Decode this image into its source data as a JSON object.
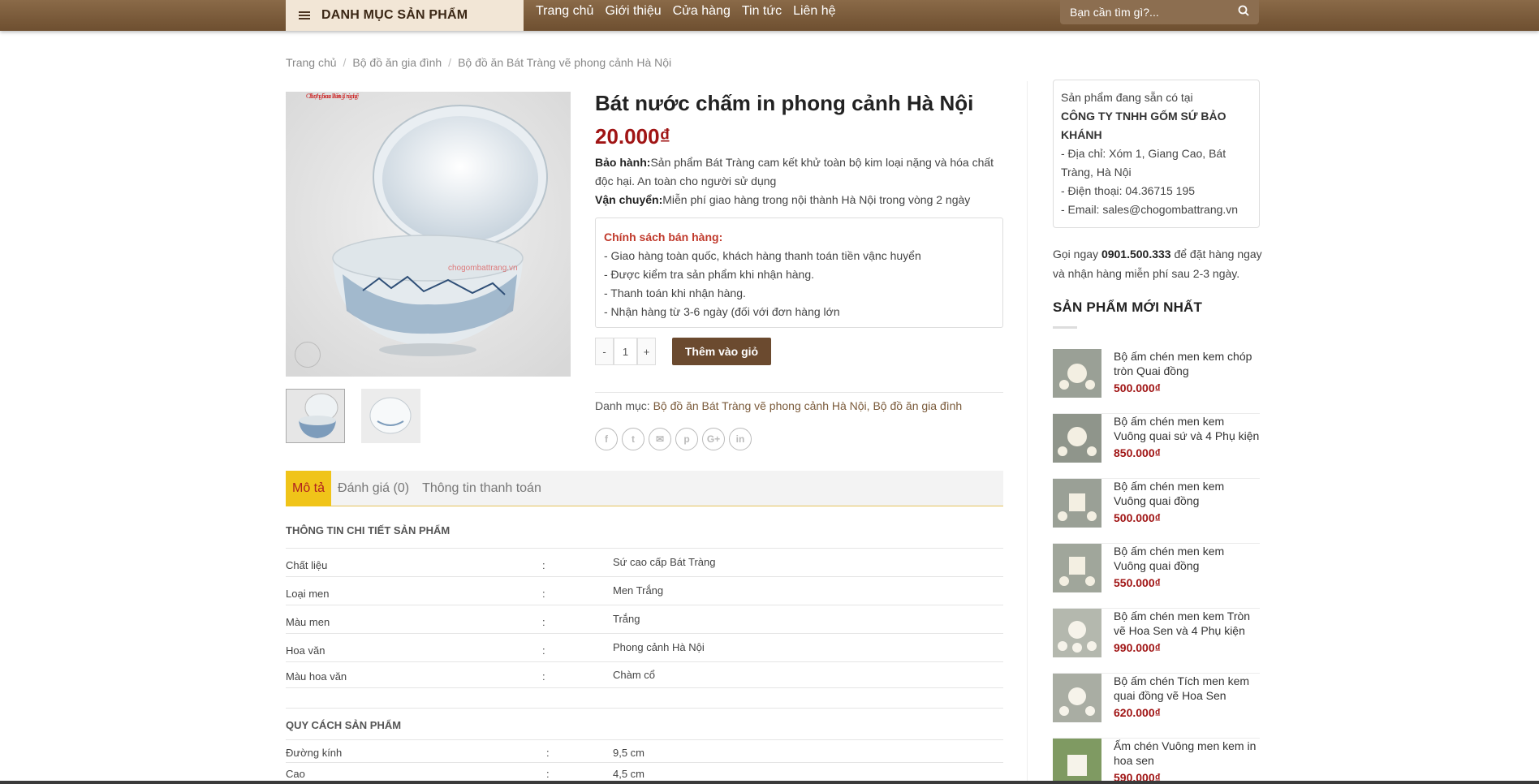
{
  "header": {
    "category_menu_label": "DANH MỤC SẢN PHẨM",
    "nav": [
      "Trang chủ",
      "Giới thiệu",
      "Cửa hàng",
      "Tin tức",
      "Liên hệ"
    ],
    "search_placeholder": "Bạn cần tìm gì?..."
  },
  "breadcrumb": [
    "Trang chủ",
    "Bộ đồ ăn gia đình",
    "Bộ đồ ăn Bát Tràng vẽ phong cảnh Hà Nội"
  ],
  "product": {
    "title": "Bát nước chấm in phong cảnh Hà Nội",
    "price": "20.000₫",
    "warranty_label": "Bảo hành:",
    "warranty_text": "Sản phẩm Bát Tràng cam kết khử toàn bộ kim loại nặng và hóa chất độc hại. An toàn cho người sử dụng",
    "shipping_label": "Vận chuyển:",
    "shipping_text": "Miễn phí giao hàng trong nội thành Hà Nội trong vòng 2 ngày",
    "policy_title": "Chính sách bán hàng:",
    "policy_items": [
      "- Giao hàng toàn quốc, khách hàng thanh toán tiền vậnc huyển",
      "- Được kiểm tra sản phẩm khi nhận hàng.",
      "- Thanh toán khi nhận hàng.",
      "- Nhận hàng từ 3-6 ngày (đối với đơn hàng lớn"
    ],
    "qty_minus": "-",
    "qty_value": "1",
    "qty_plus": "+",
    "add_to_cart": "Thêm vào giỏ",
    "category_label": "Danh mục:",
    "categories": "Bộ đồ ăn Bát Tràng vẽ phong cảnh Hà Nội, Bộ đồ ăn gia đình",
    "image_watermark_line1": "Chợ gốm Bát Tràng",
    "image_watermark_line2": "Tinh hoa làng nghề",
    "share_icons": [
      "f",
      "t",
      "✉",
      "p",
      "G+",
      "in"
    ]
  },
  "tabs": [
    "Mô tả",
    "Đánh giá (0)",
    "Thông tin thanh toán"
  ],
  "details": {
    "heading": "THÔNG TIN CHI TIẾT SẢN PHẨM",
    "rows": [
      {
        "k": "Chất liệu",
        "c": ":",
        "v": "Sứ cao cấp Bát Tràng"
      },
      {
        "k": "Loại men",
        "c": ":",
        "v": "Men Trắng"
      },
      {
        "k": "Màu men",
        "c": ":",
        "v": "Trắng"
      },
      {
        "k": "Hoa văn",
        "c": ":",
        "v": "Phong cảnh Hà Nội"
      },
      {
        "k": "Màu hoa văn",
        "c": ":",
        "v": " Chàm cổ"
      }
    ]
  },
  "specs": {
    "heading": "QUY CÁCH SẢN PHẨM",
    "rows": [
      {
        "k": "Đường kính",
        "c": ":",
        "v": "9,5 cm"
      },
      {
        "k": " Cao",
        "c": ":",
        "v": "4,5 cm"
      }
    ]
  },
  "store": {
    "line1": "Sản phẩm đang sẵn có tại",
    "company": "CÔNG TY TNHH GỐM SỨ BẢO KHÁNH",
    "address": "- Địa chỉ: Xóm 1, Giang Cao, Bát Tràng, Hà Nội",
    "phone": "- Điện thoại: 04.36715 195",
    "email": "- Email: sales@chogombattrang.vn"
  },
  "call": {
    "prefix": "Gọi ngay ",
    "phone": "0901.500.333",
    "suffix": " để đặt hàng ngay và nhận hàng miễn phí sau 2-3 ngày."
  },
  "sidebar_title": "SẢN PHẨM MỚI NHẤT",
  "latest_products": [
    {
      "name": "Bộ ấm chén men kem chóp tròn Quai đồng",
      "price": "500.000₫"
    },
    {
      "name": "Bộ ấm chén men kem Vuông quai sứ và 4 Phụ kiện",
      "price": "850.000₫"
    },
    {
      "name": "Bộ ấm chén men kem Vuông quai đồng",
      "price": "500.000₫"
    },
    {
      "name": "Bộ ấm chén men kem Vuông quai đồng",
      "price": "550.000₫"
    },
    {
      "name": "Bộ ấm chén men kem Tròn vẽ Hoa Sen và 4 Phụ kiện",
      "price": "990.000₫"
    },
    {
      "name": "Bộ ấm chén Tích men kem quai đồng vẽ Hoa Sen",
      "price": "620.000₫"
    },
    {
      "name": "Ấm chén Vuông men kem in hoa sen",
      "price": "590.000₫"
    }
  ],
  "colors": {
    "header_brown": "#7a5a3a",
    "price_red": "#a01414",
    "tab_active": "#f0c419",
    "button_brown": "#6b4a2f"
  }
}
